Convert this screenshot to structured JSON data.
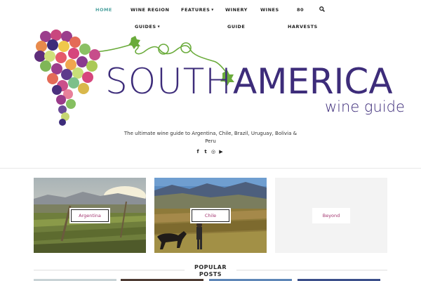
{
  "nav": {
    "row1": [
      {
        "label": "HOME",
        "active": true
      },
      {
        "label": "WINE REGION",
        "active": false
      },
      {
        "label": "FEATURES",
        "active": false,
        "dropdown": true
      },
      {
        "label": "WINERY",
        "active": false
      },
      {
        "label": "WINES",
        "active": false
      },
      {
        "label": "80",
        "active": false
      }
    ],
    "row2": [
      {
        "label": "GUIDES",
        "dropdown": true
      },
      {
        "label": "GUIDE"
      },
      {
        "label": "HARVESTS"
      }
    ],
    "search_icon": "search-icon",
    "chevron_icon": "▾"
  },
  "logo": {
    "south": "SOUTH",
    "america": "AMERICA",
    "sub": "wine guide"
  },
  "tagline": "The ultimate wine guide to Argentina, Chile, Brazil, Uruguay, Bolivia & Peru",
  "social": [
    {
      "icon": "facebook-icon",
      "glyph": "f"
    },
    {
      "icon": "twitter-icon",
      "glyph": "t"
    },
    {
      "icon": "instagram-icon",
      "glyph": "◎"
    },
    {
      "icon": "youtube-icon",
      "glyph": "▶"
    }
  ],
  "cards": [
    {
      "label": "Argentina"
    },
    {
      "label": "Chile"
    },
    {
      "label": "Beyond"
    }
  ],
  "popular_posts": {
    "title": "POPULAR POSTS"
  },
  "colors": {
    "accent": "#4fa3a0",
    "brand_purple": "#3d2c7a",
    "label_magenta": "#a2346f"
  }
}
